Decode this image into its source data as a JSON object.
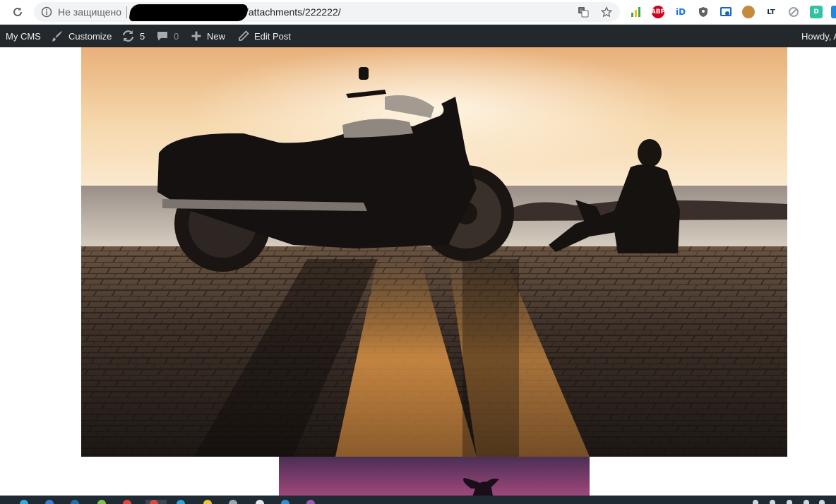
{
  "browser": {
    "insecure_label": "Не защищено",
    "url_suffix": "/attachments/222222/",
    "icons": [
      "reload-icon",
      "info-icon",
      "translate-icon",
      "bookmark-star-icon"
    ],
    "extensions": [
      {
        "name": "bar-chart-extension-icon",
        "color": "#f9ab00",
        "label": ""
      },
      {
        "name": "adblock-plus-extension-icon",
        "color": "#d0021b",
        "label": "ABP"
      },
      {
        "name": "id-extension-icon",
        "color": "#1a73e8",
        "label": "iD"
      },
      {
        "name": "shield-extension-icon",
        "color": "#5f6368",
        "label": ""
      },
      {
        "name": "window-capture-extension-icon",
        "color": "#1565c0",
        "label": ""
      },
      {
        "name": "cookie-extension-icon",
        "color": "#c58b3c",
        "label": ""
      },
      {
        "name": "lt-extension-icon",
        "color": "#ffffff",
        "label": "LT"
      },
      {
        "name": "blocked-extension-icon",
        "color": "#9aa0a6",
        "label": ""
      },
      {
        "name": "d-extension-icon",
        "color": "#2ec4a0",
        "label": "D"
      },
      {
        "name": "s-extension-icon",
        "color": "#1e88e5",
        "label": ""
      }
    ]
  },
  "adminbar": {
    "site_name": "My CMS",
    "customize": "Customize",
    "updates_count": "5",
    "comments_count": "0",
    "new_label": "New",
    "edit_post": "Edit Post",
    "howdy": "Howdy, A",
    "colors": {
      "bar": "#23282d",
      "text": "#eeeeee",
      "dim": "#8c8f94"
    }
  },
  "content": {
    "main_image": "motorcycle-at-sunset-photo",
    "second_image": "palm-at-dusk-photo"
  }
}
